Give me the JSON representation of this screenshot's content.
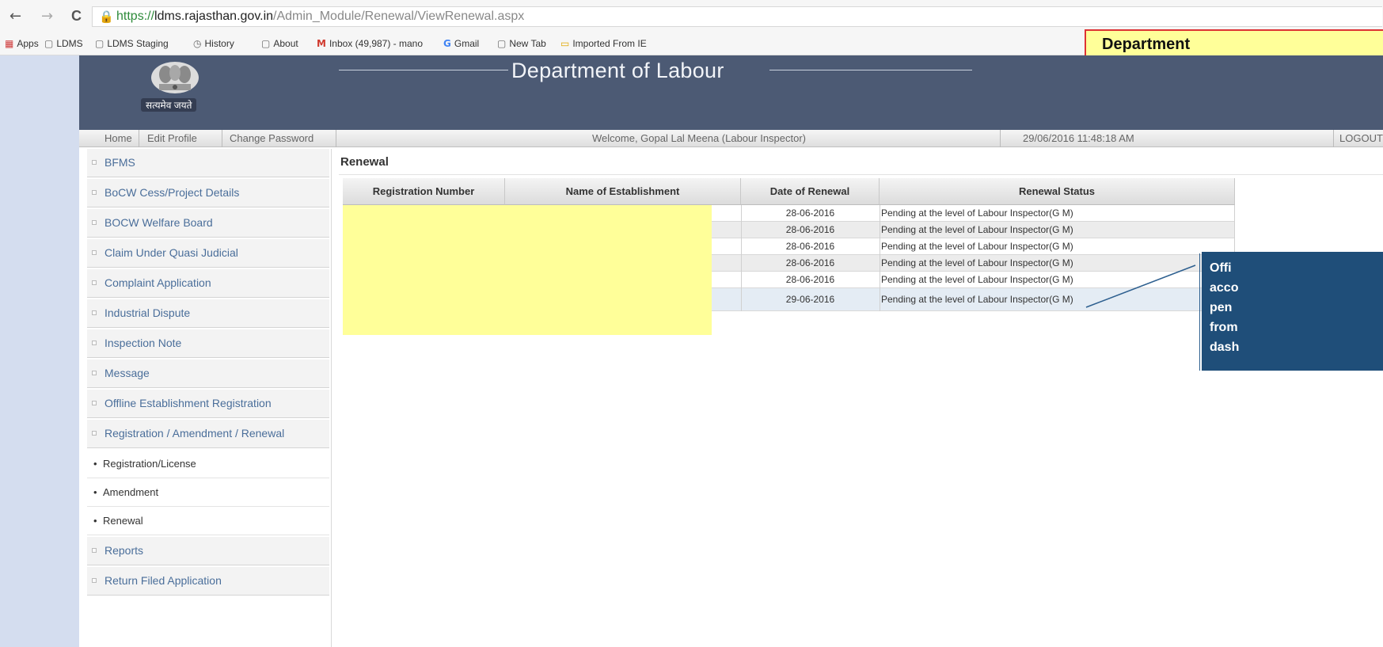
{
  "browser": {
    "back_icon": "←",
    "forward_icon": "→",
    "reload_icon": "C",
    "lock_icon": "🔒",
    "url_scheme": "https://",
    "url_host": "ldms.rajasthan.gov.in",
    "url_path": "/Admin_Module/Renewal/ViewRenewal.aspx",
    "bookmarks": [
      {
        "icon": "▦",
        "label": "Apps"
      },
      {
        "icon": "▢",
        "label": "LDMS"
      },
      {
        "icon": "▢",
        "label": "LDMS Staging"
      },
      {
        "icon": "◷",
        "label": "History"
      },
      {
        "icon": "▢",
        "label": "About"
      },
      {
        "icon": "M",
        "label": "Inbox (49,987) - mano"
      },
      {
        "icon": "G",
        "label": "Gmail"
      },
      {
        "icon": "▢",
        "label": "New Tab"
      },
      {
        "icon": "▭",
        "label": "Imported From IE"
      }
    ]
  },
  "callout_top": "Department",
  "header": {
    "emblem_caption": "सत्यमेव जयते",
    "title": "Department of Labour"
  },
  "topnav": {
    "home": "Home",
    "edit_profile": "Edit Profile",
    "change_password": "Change Password",
    "welcome": "Welcome, Gopal Lal Meena (Labour Inspector)",
    "datetime": "29/06/2016 11:48:18 AM",
    "logout": "LOGOUT"
  },
  "sidebar": {
    "items": [
      "BFMS",
      "BoCW Cess/Project Details",
      "BOCW Welfare Board",
      "Claim Under Quasi Judicial",
      "Complaint Application",
      "Industrial Dispute",
      "Inspection Note",
      "Message",
      "Offline Establishment Registration",
      "Registration / Amendment / Renewal"
    ],
    "subitems": [
      "Registration/License",
      "Amendment",
      "Renewal"
    ],
    "items_after": [
      "Reports",
      "Return Filed Application"
    ]
  },
  "main": {
    "title": "Renewal",
    "columns": [
      "Registration Number",
      "Name of Establishment",
      "Date of Renewal",
      "Renewal Status"
    ],
    "rows": [
      {
        "date": "28-06-2016",
        "status": "Pending at the level of Labour Inspector(G M)"
      },
      {
        "date": "28-06-2016",
        "status": "Pending at the level of Labour Inspector(G M)"
      },
      {
        "date": "28-06-2016",
        "status": "Pending at the level of Labour Inspector(G M)"
      },
      {
        "date": "28-06-2016",
        "status": "Pending at the level of Labour Inspector(G M)"
      },
      {
        "date": "28-06-2016",
        "status": "Pending at the level of Labour Inspector(G M)"
      },
      {
        "date": "29-06-2016",
        "status": "Pending at the level of Labour Inspector(G M)"
      }
    ]
  },
  "note_text": "Offi\nacco\npen\nfrom\ndash"
}
